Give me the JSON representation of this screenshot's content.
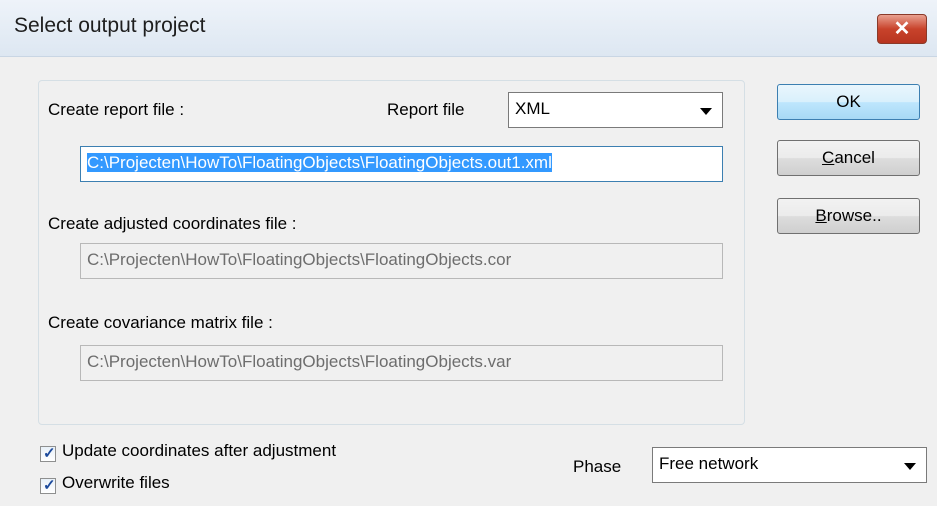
{
  "window": {
    "title": "Select output project",
    "close_glyph": "✕"
  },
  "report": {
    "label": "Create report file :",
    "type_label": "Report file",
    "type_value": "XML",
    "path": "C:\\Projecten\\HowTo\\FloatingObjects\\FloatingObjects.out1.xml"
  },
  "coordinates": {
    "label": "Create adjusted coordinates file :",
    "path": "C:\\Projecten\\HowTo\\FloatingObjects\\FloatingObjects.cor"
  },
  "covariance": {
    "label": "Create covariance matrix file :",
    "path": "C:\\Projecten\\HowTo\\FloatingObjects\\FloatingObjects.var"
  },
  "buttons": {
    "ok": "OK",
    "cancel_mnemonic": "C",
    "cancel_rest": "ancel",
    "browse_mnemonic": "B",
    "browse_rest": "rowse.."
  },
  "options": {
    "update_label": "Update coordinates after adjustment",
    "update_checked": true,
    "overwrite_label": "Overwrite files",
    "overwrite_checked": true
  },
  "phase": {
    "label": "Phase",
    "value": "Free network"
  },
  "icons": {
    "check": "check-icon",
    "dropdown": "chevron-down-icon",
    "close": "close-icon"
  }
}
